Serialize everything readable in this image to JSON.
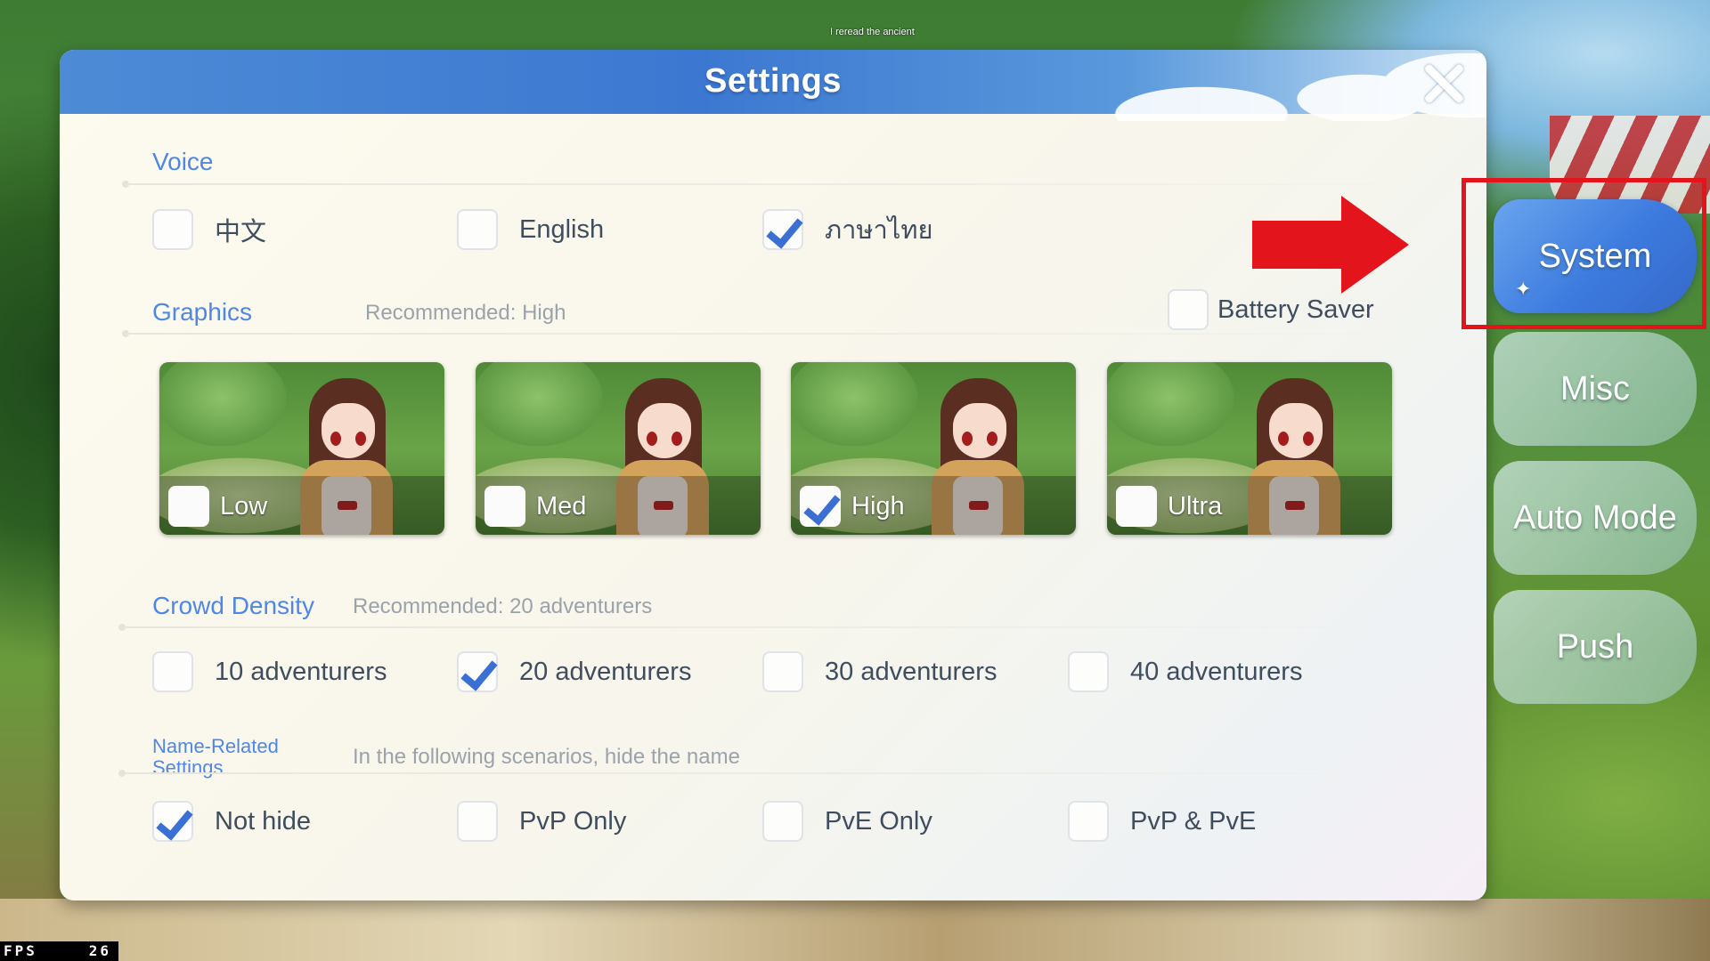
{
  "dialog": {
    "title": "Settings"
  },
  "speech_text": "I reread the ancient",
  "voice": {
    "title": "Voice",
    "options": [
      {
        "label": "中文",
        "checked": false
      },
      {
        "label": "English",
        "checked": false
      },
      {
        "label": "ภาษาไทย",
        "checked": true
      }
    ]
  },
  "graphics": {
    "title": "Graphics",
    "recommendation": "Recommended: High",
    "battery_saver": {
      "label": "Battery Saver",
      "checked": false
    },
    "options": [
      {
        "label": "Low",
        "checked": false
      },
      {
        "label": "Med",
        "checked": false
      },
      {
        "label": "High",
        "checked": true
      },
      {
        "label": "Ultra",
        "checked": false
      }
    ]
  },
  "crowd": {
    "title": "Crowd Density",
    "recommendation": "Recommended: 20 adventurers",
    "options": [
      {
        "label": "10 adventurers",
        "checked": false
      },
      {
        "label": "20 adventurers",
        "checked": true
      },
      {
        "label": "30 adventurers",
        "checked": false
      },
      {
        "label": "40 adventurers",
        "checked": false
      }
    ]
  },
  "name_settings": {
    "title_line1": "Name-Related",
    "title_line2": "Settings",
    "description": "In the following scenarios, hide the name",
    "options": [
      {
        "label": "Not hide",
        "checked": true
      },
      {
        "label": "PvP Only",
        "checked": false
      },
      {
        "label": "PvE Only",
        "checked": false
      },
      {
        "label": "PvP & PvE",
        "checked": false
      }
    ]
  },
  "tabs": [
    {
      "label": "System",
      "active": true
    },
    {
      "label": "Misc",
      "active": false
    },
    {
      "label": "Auto Mode",
      "active": false
    },
    {
      "label": "Push",
      "active": false
    }
  ],
  "fps": {
    "label": "FPS",
    "value": "26"
  },
  "colors": {
    "accent": "#4f87e6",
    "check": "#3a6fd4",
    "annotation_red": "#e3141b"
  }
}
